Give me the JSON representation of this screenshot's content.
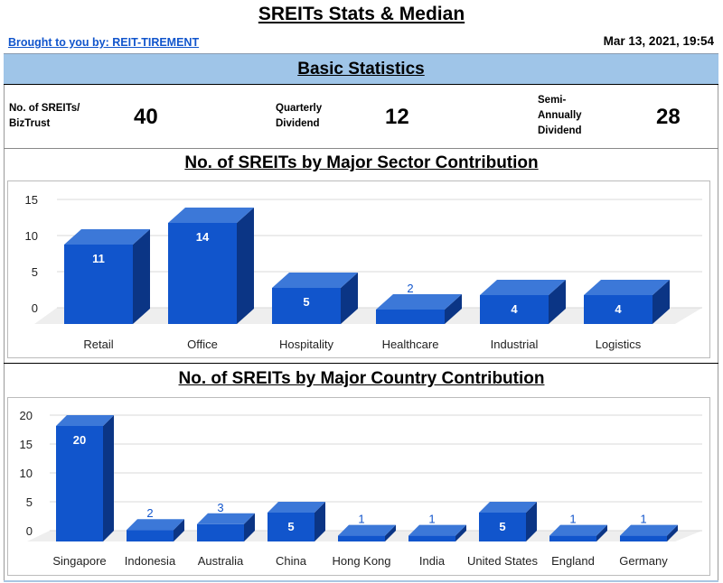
{
  "header": {
    "title": "SREITs Stats & Median",
    "credit": "Brought to you by: REIT-TIREMENT",
    "timestamp": "Mar 13, 2021, 19:54"
  },
  "basic_stats": {
    "heading": "Basic Statistics",
    "items": [
      {
        "label_lines": [
          "No. of SREITs/",
          "BizTrust"
        ],
        "value": "40"
      },
      {
        "label_lines": [
          "Quarterly",
          "Dividend"
        ],
        "value": "12"
      },
      {
        "label_lines": [
          "Semi-",
          "Annually",
          "Dividend"
        ],
        "value": "28"
      }
    ]
  },
  "colors": {
    "bar_front": "#1155cc",
    "bar_top": "#3c78d8",
    "bar_side": "#0b3585",
    "label_inside": "#ffffff",
    "label_outside": "#1155cc",
    "band": "#9fc5e8",
    "link": "#1155cc"
  },
  "chart_data": [
    {
      "type": "bar",
      "style": "3d",
      "title": "No. of SREITs by Major Sector Contribution",
      "xlabel": "",
      "ylabel": "",
      "categories": [
        "Retail",
        "Office",
        "Hospitality",
        "Healthcare",
        "Industrial",
        "Logistics"
      ],
      "values": [
        11,
        14,
        5,
        2,
        4,
        4
      ],
      "ylim": [
        0,
        15
      ],
      "yticks": [
        0,
        5,
        10,
        15
      ],
      "grid": true,
      "legend": "none",
      "data_labels": true
    },
    {
      "type": "bar",
      "style": "3d",
      "title": "No. of SREITs by Major Country Contribution",
      "xlabel": "",
      "ylabel": "",
      "categories": [
        "Singapore",
        "Indonesia",
        "Australia",
        "China",
        "Hong Kong",
        "India",
        "United States",
        "England",
        "Germany"
      ],
      "values": [
        20,
        2,
        3,
        5,
        1,
        1,
        5,
        1,
        1
      ],
      "ylim": [
        0,
        20
      ],
      "yticks": [
        0,
        5,
        10,
        15,
        20
      ],
      "grid": true,
      "legend": "none",
      "data_labels": true
    }
  ]
}
